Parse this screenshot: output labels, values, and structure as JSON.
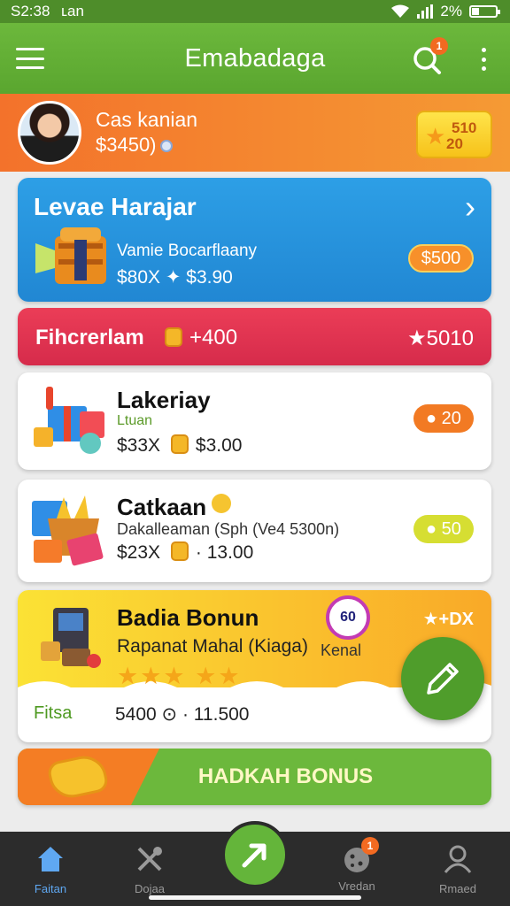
{
  "status_bar": {
    "time": "S2:38",
    "carrier": "ʟan",
    "battery_text": "2%"
  },
  "app_bar": {
    "title": "Emabadaga",
    "notification_count": "1"
  },
  "profile": {
    "name": "Cas kanian",
    "balance": "$3450)",
    "points_line1": "510",
    "points_line2": "20"
  },
  "featured": {
    "title": "Levae Harajar",
    "subtitle": "Vamie Bocarflaany",
    "price": "$80X ✦ $3.90",
    "pill": "$500"
  },
  "promo_bar": {
    "left": "Fihcrerlam",
    "middle": "+400",
    "right": "★5010"
  },
  "items": [
    {
      "title": "Lakeriay",
      "subtitle": "Ltuan",
      "price_left": "$33X",
      "price_right": "$3.00",
      "pill": "● 20",
      "pill_color": "#f27a23"
    },
    {
      "title": "Catkaan",
      "subtitle": "Dakalleaman (Sph  (Ve4 5300n)",
      "price_left": "$23X",
      "price_right": "· 13.00",
      "pill": "● 50",
      "pill_color": "#d6de32"
    }
  ],
  "bonus_card": {
    "title": "Badia Bonun",
    "subtitle": "Rapanat Mahal (Kiaga)",
    "stars": "★★★  ★★",
    "badge": "60",
    "badge_label": "Kenal",
    "top_right": "★+DX",
    "footer_left": "Fitsa",
    "footer_price": "5400 ⊙ · 11.500"
  },
  "banner": {
    "text": "HADKAH BONUS"
  },
  "bottom_nav": {
    "items": [
      {
        "label": "Faitan",
        "icon": "home-icon"
      },
      {
        "label": "Dojaa",
        "icon": "tools-icon"
      },
      {
        "label": "Vredan",
        "icon": "cookie-icon",
        "badge": "1"
      },
      {
        "label": "Rmaed",
        "icon": "person-icon"
      }
    ]
  },
  "colors": {
    "green": "#5aa62f",
    "orange": "#f3722b",
    "blue": "#2d9fe6",
    "red": "#e33a55",
    "nav_active": "#5fa8f2"
  }
}
